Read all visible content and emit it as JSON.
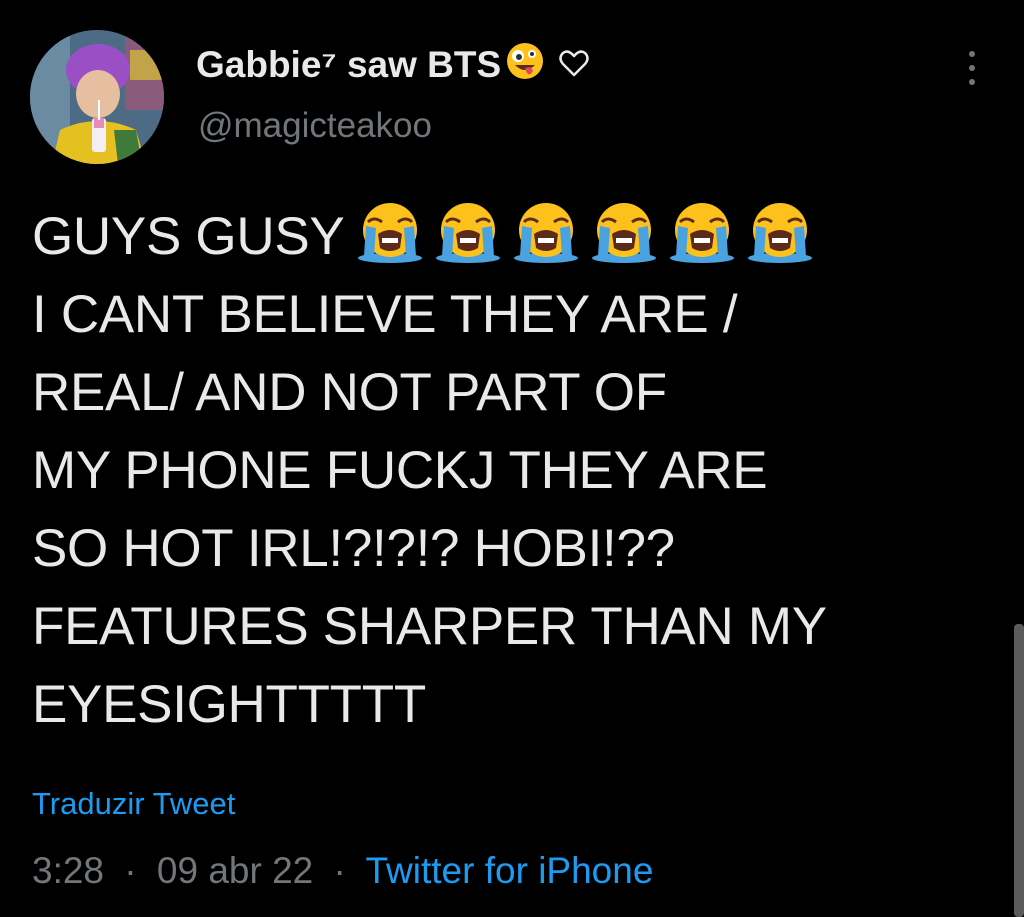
{
  "author": {
    "display_name": "Gabbie⁷ saw BTS",
    "name_emoji": "zany-face-icon",
    "name_heart": "white-heart-icon",
    "handle": "@magicteakoo"
  },
  "tweet": {
    "first_line": "GUYS GUSY",
    "first_line_emojis": [
      "loudly-crying-face-icon",
      "loudly-crying-face-icon",
      "loudly-crying-face-icon",
      "loudly-crying-face-icon",
      "loudly-crying-face-icon",
      "loudly-crying-face-icon"
    ],
    "body": "I CANT BELIEVE THEY ARE /\nREAL/ AND NOT PART OF\nMY PHONE FUCKJ THEY ARE\nSO HOT IRL!?!?!? HOBI!??\nFEATURES SHARPER THAN MY\nEYESIGHTTTTT"
  },
  "translate_label": "Traduzir Tweet",
  "meta": {
    "time": "3:28",
    "date": "09 abr 22",
    "separator": "·",
    "source": "Twitter for iPhone"
  },
  "colors": {
    "background": "#000000",
    "text": "#e7e9ea",
    "secondary": "#71767b",
    "link": "#1d9bf0"
  }
}
